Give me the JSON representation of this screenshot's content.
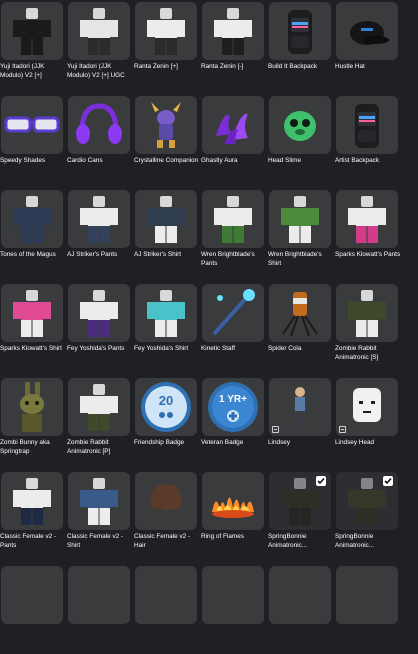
{
  "items": [
    {
      "name": "Yuji Itadori (JJK Modulo) V2 [+]",
      "icon": "avatar-outfit-icon",
      "shirt": "#1a1a1a",
      "pants": "#1a1a1a",
      "checked": false,
      "limited": false
    },
    {
      "name": "Yuji Itadori (JJK Modulo) V2 [+] UGC",
      "icon": "avatar-outfit-icon",
      "shirt": "#e6e6e6",
      "pants": "#2b2b2b",
      "checked": false,
      "limited": false
    },
    {
      "name": "Ranta Zenin [+]",
      "icon": "avatar-outfit-icon",
      "shirt": "#ececec",
      "pants": "#2b2b2b",
      "checked": false,
      "limited": false
    },
    {
      "name": "Ranta Zenin [-]",
      "icon": "avatar-outfit-icon",
      "shirt": "#ececec",
      "pants": "#1e1e1e",
      "checked": false,
      "limited": false
    },
    {
      "name": "Build It Backpack",
      "icon": "backpack-icon",
      "checked": false,
      "limited": false
    },
    {
      "name": "Hustle Hat",
      "icon": "cap-icon",
      "checked": false,
      "limited": false
    },
    {
      "name": "Speedy Shades",
      "icon": "glasses-icon",
      "checked": false,
      "limited": false
    },
    {
      "name": "Cardio Cans",
      "icon": "headphones-icon",
      "checked": false,
      "limited": false
    },
    {
      "name": "Crystalline Companion",
      "icon": "pet-icon",
      "checked": false,
      "limited": false
    },
    {
      "name": "Ghastly Aura",
      "icon": "aura-icon",
      "checked": false,
      "limited": false
    },
    {
      "name": "Head Slime",
      "icon": "slime-icon",
      "checked": false,
      "limited": false
    },
    {
      "name": "Artist Backpack",
      "icon": "backpack-icon",
      "checked": false,
      "limited": false
    },
    {
      "name": "Tones of the Magus",
      "icon": "avatar-outfit-icon",
      "shirt": "#2d3b55",
      "pants": "#2d3b55",
      "checked": false,
      "limited": false
    },
    {
      "name": "AJ Striker's Pants",
      "icon": "avatar-outfit-icon",
      "shirt": "#ececec",
      "pants": "#33415a",
      "checked": false,
      "limited": false
    },
    {
      "name": "AJ Striker's Shirt",
      "icon": "avatar-outfit-icon",
      "shirt": "#2f3d4f",
      "pants": "#ececec",
      "checked": false,
      "limited": false
    },
    {
      "name": "Wren Brightblade's Pants",
      "icon": "avatar-outfit-icon",
      "shirt": "#ececec",
      "pants": "#3e7b35",
      "checked": false,
      "limited": false
    },
    {
      "name": "Wren Brightblade's Shirt",
      "icon": "avatar-outfit-icon",
      "shirt": "#4b8a3b",
      "pants": "#ececec",
      "checked": false,
      "limited": false
    },
    {
      "name": "Sparks Klowatt's Pants",
      "icon": "avatar-outfit-icon",
      "shirt": "#ececec",
      "pants": "#d23c8a",
      "checked": false,
      "limited": false
    },
    {
      "name": "Sparks Klowatt's Shirt",
      "icon": "avatar-outfit-icon",
      "shirt": "#e04a95",
      "pants": "#ececec",
      "checked": false,
      "limited": false
    },
    {
      "name": "Fey Yoshida's Pants",
      "icon": "avatar-outfit-icon",
      "shirt": "#ececec",
      "pants": "#4a2c7c",
      "checked": false,
      "limited": false
    },
    {
      "name": "Fey Yoshida's Shirt",
      "icon": "avatar-outfit-icon",
      "shirt": "#49c2c9",
      "pants": "#ececec",
      "checked": false,
      "limited": false
    },
    {
      "name": "Kinetic Staff",
      "icon": "staff-icon",
      "checked": false,
      "limited": false
    },
    {
      "name": "Spider Cola",
      "icon": "spider-cola-icon",
      "checked": false,
      "limited": false
    },
    {
      "name": "Zombie Rabbit Animatronic [S]",
      "icon": "avatar-outfit-icon",
      "shirt": "#3f4a2b",
      "pants": "#ececec",
      "checked": false,
      "limited": false
    },
    {
      "name": "Zombi Bunny aka Springtrap",
      "icon": "springtrap-icon",
      "checked": false,
      "limited": false
    },
    {
      "name": "Zombie Rabbit Animatronic [P]",
      "icon": "avatar-outfit-icon",
      "shirt": "#ececec",
      "pants": "#3f4a2b",
      "checked": false,
      "limited": false
    },
    {
      "name": "Friendship Badge",
      "icon": "friendship-badge-icon",
      "badge_text": "20",
      "checked": false,
      "limited": false
    },
    {
      "name": "Veteran Badge",
      "icon": "veteran-badge-icon",
      "badge_text": "1 YR+",
      "checked": false,
      "limited": false
    },
    {
      "name": "Lindsey",
      "icon": "lindsey-figure-icon",
      "checked": false,
      "limited": true
    },
    {
      "name": "Lindsey Head",
      "icon": "head-icon",
      "checked": false,
      "limited": true
    },
    {
      "name": "Classic Female v2 - Pants",
      "icon": "avatar-outfit-icon",
      "shirt": "#ececec",
      "pants": "#1e2a44",
      "checked": false,
      "limited": false
    },
    {
      "name": "Classic Female v2 - Shirt",
      "icon": "avatar-outfit-icon",
      "shirt": "#3a5a8a",
      "pants": "#ececec",
      "checked": false,
      "limited": false
    },
    {
      "name": "Classic Female v2 - Hair",
      "icon": "hair-icon",
      "checked": false,
      "limited": false
    },
    {
      "name": "Ring of Flames",
      "icon": "flame-ring-icon",
      "checked": false,
      "limited": false
    },
    {
      "name": "SpringBonnie Animatronic...",
      "icon": "avatar-outfit-icon",
      "shirt": "#3a3d2a",
      "pants": "#2a2a24",
      "checked": true,
      "limited": false,
      "dim": true
    },
    {
      "name": "SpringBonnie Animatronic...",
      "icon": "avatar-outfit-icon",
      "shirt": "#4a4a2c",
      "pants": "#3a3a24",
      "checked": true,
      "limited": false,
      "dim": true
    },
    {
      "name": "",
      "icon": "blank-icon",
      "checked": false,
      "limited": false
    },
    {
      "name": "",
      "icon": "blank-icon",
      "checked": false,
      "limited": false
    },
    {
      "name": "",
      "icon": "blank-icon",
      "checked": false,
      "limited": false
    },
    {
      "name": "",
      "icon": "blank-icon",
      "checked": false,
      "limited": false
    },
    {
      "name": "",
      "icon": "blank-icon",
      "checked": false,
      "limited": false
    },
    {
      "name": "",
      "icon": "blank-icon",
      "checked": false,
      "limited": false
    }
  ]
}
